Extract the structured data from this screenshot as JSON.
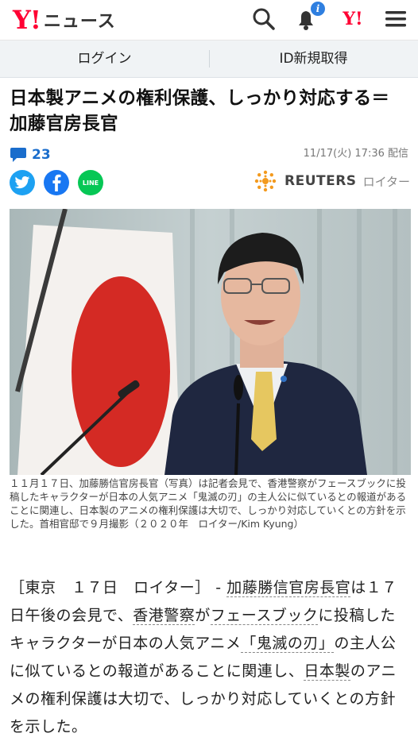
{
  "header": {
    "logo_y": "Y!",
    "logo_text": "ニュース",
    "notification_count": "i",
    "ymark": "Y!",
    "icons": [
      "search-icon",
      "bell-icon",
      "yahoo-icon",
      "menu-icon"
    ]
  },
  "auth": {
    "login": "ログイン",
    "signup": "ID新規取得"
  },
  "article": {
    "headline": "日本製アニメの権利保護、しっかり対応する＝加藤官房長官",
    "comment_count": "23",
    "date": "11/17(火) 17:36 配信",
    "source_name": "REUTERS",
    "source_kana": "ロイター",
    "share": [
      "twitter",
      "facebook",
      "line"
    ],
    "line_label": "LINE",
    "caption": "１１月１７日、加藤勝信官房長官（写真）は記者会見で、香港警察がフェースブックに投稿したキャラクターが日本の人気アニメ「鬼滅の刃」の主人公に似ているとの報道があることに関連し、日本製のアニメの権利保護は大切で、しっかり対応していくとの方針を示した。首相官邸で９月撮影（２０２０年　ロイター/Kim Kyung）",
    "body": {
      "p1": "［東京　１７日　ロイター］ - ",
      "l1": "加藤勝信官房長官",
      "p2": "は１７日午後の会見で、",
      "l2": "香港警察",
      "p3": "が",
      "l3": "フェースブック",
      "p4": "に投稿したキャラクターが日本の人気アニメ",
      "l4": "「鬼滅の刃」",
      "p5": "の主人公に似ているとの報道があることに関連し、",
      "l5": "日本製",
      "p6": "のアニメの権利保護は大切で、しっかり対応していくとの方針を示した。"
    }
  },
  "colors": {
    "yahoo_red": "#ff0033",
    "link_blue": "#1a6dcc",
    "twitter": "#1da1f2",
    "facebook": "#1877f2",
    "line": "#06c755"
  }
}
